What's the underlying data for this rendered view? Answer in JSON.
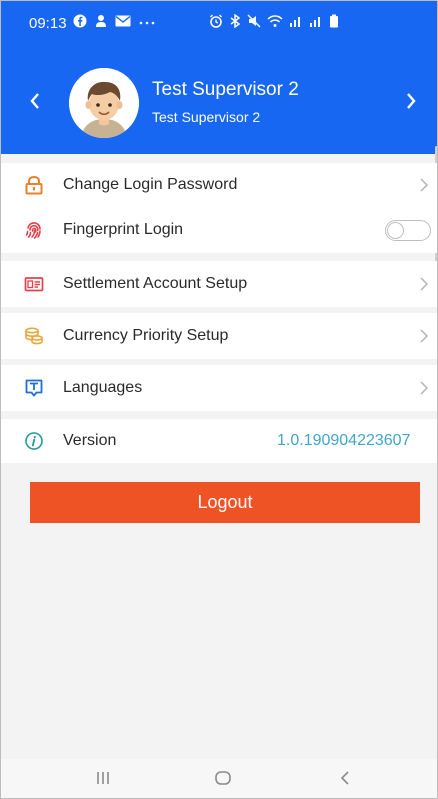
{
  "status_bar": {
    "time": "09:13"
  },
  "profile": {
    "name": "Test Supervisor 2",
    "role": "Test Supervisor 2"
  },
  "menu": {
    "change_password": "Change Login Password",
    "fingerprint": "Fingerprint Login",
    "fingerprint_enabled": false,
    "settlement": "Settlement Account Setup",
    "currency": "Currency Priority Setup",
    "languages": "Languages",
    "version_label": "Version",
    "version_value": "1.0.190904223607"
  },
  "logout_label": "Logout",
  "icons": {
    "prev": "chevron-left-icon",
    "next": "chevron-right-icon",
    "lock": "lock-icon",
    "fingerprint": "fingerprint-icon",
    "id_card": "id-card-icon",
    "coins": "coins-icon",
    "translate": "translate-icon",
    "info": "info-icon"
  },
  "colors": {
    "header": "#1767f2",
    "logout": "#ee5326",
    "icon_orange": "#e8822a",
    "icon_red": "#e0414a",
    "icon_gold": "#e8a73a",
    "icon_blue": "#1e6fd9",
    "icon_teal": "#1f9c94",
    "version_value": "#41a6c9"
  }
}
